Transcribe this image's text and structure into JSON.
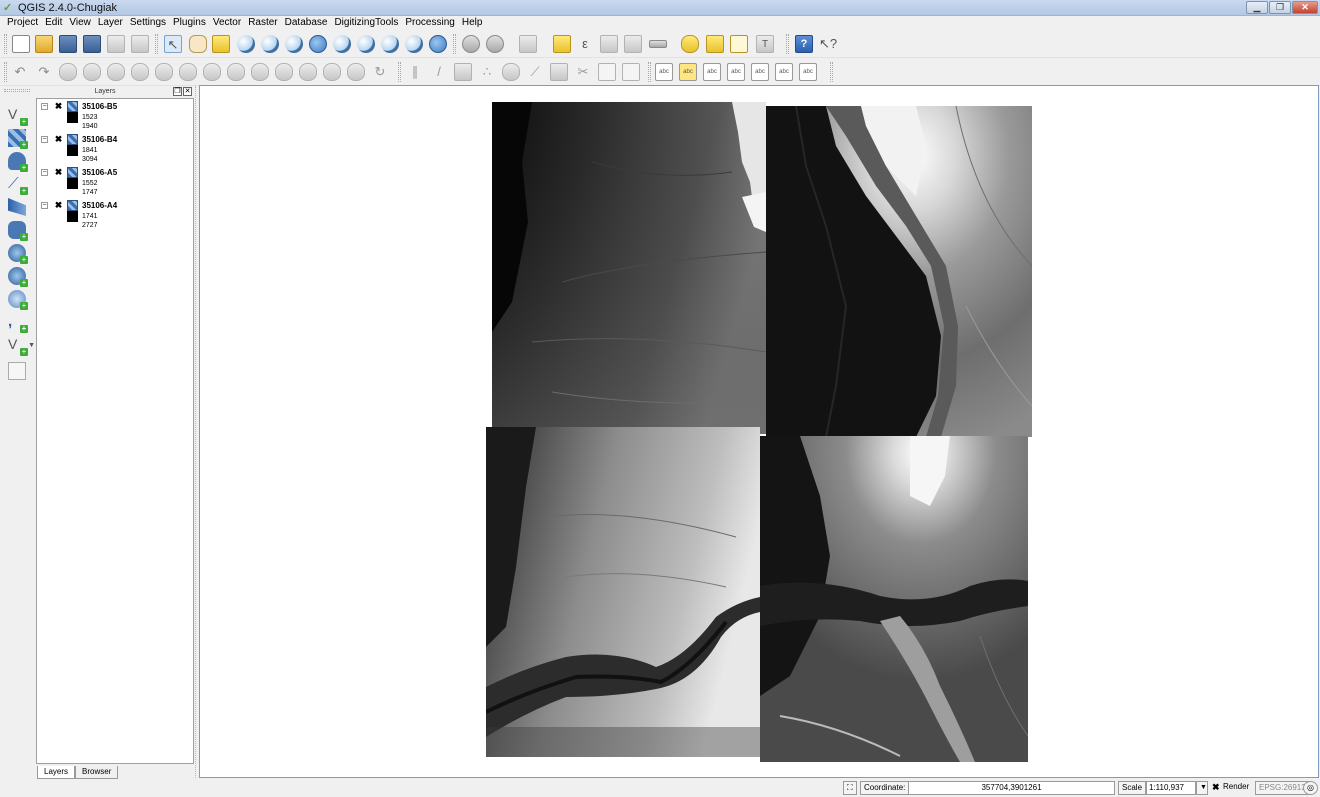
{
  "window": {
    "title": "QGIS 2.4.0-Chugiak"
  },
  "menu": [
    "Project",
    "Edit",
    "View",
    "Layer",
    "Settings",
    "Plugins",
    "Vector",
    "Raster",
    "Database",
    "DigitizingTools",
    "Processing",
    "Help"
  ],
  "layers_panel": {
    "title": "Layers",
    "layers": [
      {
        "name": "35106-B5",
        "min": "1523",
        "max": "1940"
      },
      {
        "name": "35106-B4",
        "min": "1841",
        "max": "3094"
      },
      {
        "name": "35106-A5",
        "min": "1552",
        "max": "1747"
      },
      {
        "name": "35106-A4",
        "min": "1741",
        "max": "2727"
      }
    ],
    "tabs": [
      "Layers",
      "Browser"
    ]
  },
  "statusbar": {
    "coordinate_label": "Coordinate:",
    "coordinate_value": "357704,3901261",
    "scale_label": "Scale",
    "scale_value": "1:110,937",
    "render_label": "Render",
    "crs": "EPSG:26913"
  },
  "icons": {
    "toolbar1": [
      "new-project-icon",
      "open-project-icon",
      "save-project-icon",
      "save-as-icon",
      "new-print-composer-icon",
      "composer-manager-icon",
      "touch-zoom-icon",
      "pan-icon",
      "pan-to-selection-icon",
      "zoom-in-icon",
      "zoom-out-icon",
      "zoom-actual-size-icon",
      "zoom-full-icon",
      "zoom-to-selection-icon",
      "zoom-to-layer-icon",
      "zoom-last-icon",
      "zoom-next-icon",
      "refresh-icon",
      "identify-icon",
      "select-icon",
      "select-region-icon",
      "deselect-icon",
      "select-expression-icon",
      "attribute-table-icon",
      "field-calculator-icon",
      "measure-icon",
      "map-tips-icon",
      "new-bookmark-icon",
      "show-bookmarks-icon",
      "text-annotation-icon",
      "help-icon",
      "whats-this-icon"
    ],
    "left": [
      "add-vector-layer-icon",
      "add-raster-layer-icon",
      "add-postgis-layer-icon",
      "add-spatialite-layer-icon",
      "add-mssql-layer-icon",
      "add-oracle-layer-icon",
      "add-wms-layer-icon",
      "add-wcs-layer-icon",
      "add-wfs-layer-icon",
      "add-delimited-text-icon",
      "new-vector-layer-icon",
      "add-virtual-layer-icon"
    ]
  }
}
